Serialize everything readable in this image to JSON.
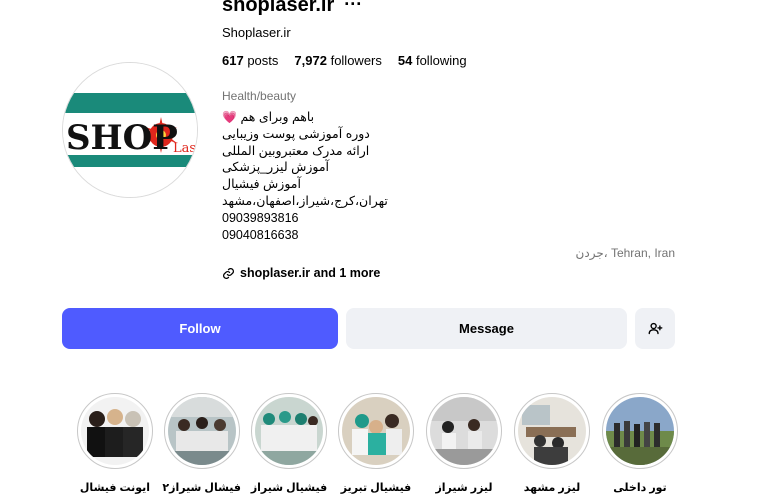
{
  "profile": {
    "username": "shoplaser.ir",
    "display_name": "Shoplaser.ir",
    "logo_text": "SHOP",
    "logo_subtext": "Laser",
    "stats": {
      "posts_count": "617",
      "posts_label": "posts",
      "followers_count": "7,972",
      "followers_label": "followers",
      "following_count": "54",
      "following_label": "following"
    },
    "category": "Health/beauty",
    "bio": [
      "باهم وبرای هم",
      "دوره آموزشی پوست وزیبایی",
      "ارائه مدرک معتبروبین المللی",
      "آموزش لیزر_پزشکی",
      "آموزش فیشیال",
      "تهران،کرج،شیراز،اصفهان،مشهد",
      "09039893816",
      "09040816638"
    ],
    "location": "جردن، Tehran, Iran",
    "link_text": "shoplaser.ir and 1 more"
  },
  "actions": {
    "follow_label": "Follow",
    "message_label": "Message"
  },
  "highlights": [
    {
      "label": "تور داخلی",
      "icon": "highlight-tour-thumbnail"
    },
    {
      "label": "لیزر مشهد",
      "icon": "highlight-laser-mashhad-thumbnail"
    },
    {
      "label": "لیزر شیراز",
      "icon": "highlight-laser-shiraz-thumbnail"
    },
    {
      "label": "فیشیال تبریز",
      "icon": "highlight-facial-tabriz-thumbnail"
    },
    {
      "label": "فیشیال شیراز",
      "icon": "highlight-facial-shiraz-thumbnail"
    },
    {
      "label": "فیشال شیراز۲",
      "icon": "highlight-facial-shiraz2-thumbnail"
    },
    {
      "label": "ایونت فیشال",
      "icon": "highlight-facial-event-thumbnail"
    }
  ],
  "colors": {
    "accent": "#4f5bff",
    "secondary_button": "#eff1f5",
    "muted_text": "#737373",
    "logo_teal": "#1a8a7a",
    "logo_red": "#e0261c"
  },
  "icons": {
    "more": "more-options-icon",
    "link": "link-icon",
    "add_user": "add-user-icon",
    "heart": "heart-emoji-icon"
  }
}
